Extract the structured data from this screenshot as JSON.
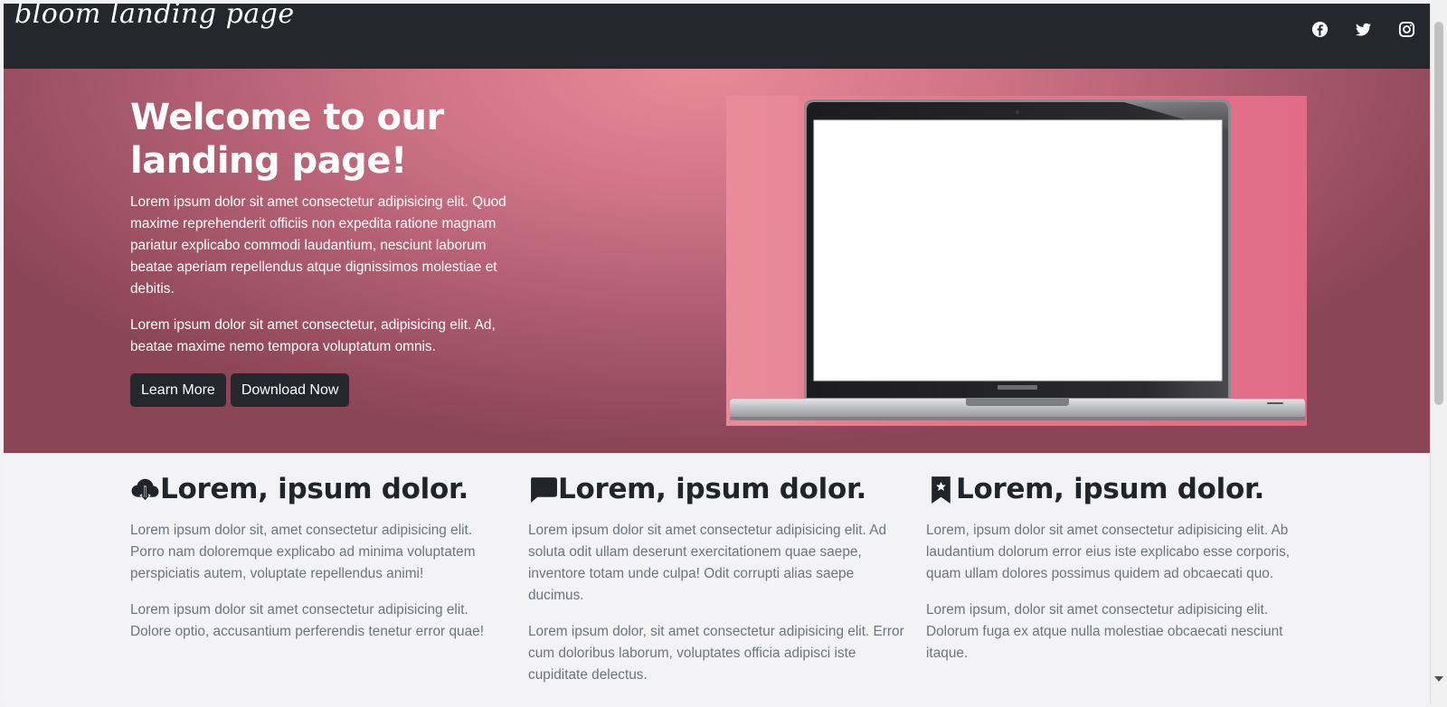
{
  "navbar": {
    "brand": "bloom landing page",
    "social": [
      {
        "name": "facebook-icon"
      },
      {
        "name": "twitter-icon"
      },
      {
        "name": "instagram-icon"
      }
    ]
  },
  "hero": {
    "title": "Welcome to our landing page!",
    "paragraph1": "Lorem ipsum dolor sit amet consectetur adipisicing elit. Quod maxime reprehenderit officiis non expedita ratione magnam pariatur explicabo commodi laudantium, nesciunt laborum beatae aperiam repellendus atque dignissimos molestiae et debitis.",
    "paragraph2": "Lorem ipsum dolor sit amet consectetur, adipisicing elit. Ad, beatae maxime nemo tempora voluptatum omnis.",
    "learn_more": "Learn More",
    "download_now": "Download Now",
    "image": "laptop-image",
    "accent_color": "#cf7386",
    "button_color": "#24272b"
  },
  "features": [
    {
      "icon": "cloud-download-icon",
      "title": "Lorem, ipsum dolor.",
      "p1": "Lorem ipsum dolor sit, amet consectetur adipisicing elit. Porro nam doloremque explicabo ad minima voluptatem perspiciatis autem, voluptate repellendus animi!",
      "p2": "Lorem ipsum dolor sit amet consectetur adipisicing elit. Dolore optio, accusantium perferendis tenetur error quae!"
    },
    {
      "icon": "chat-icon",
      "title": "Lorem, ipsum dolor.",
      "p1": "Lorem ipsum dolor sit amet consectetur adipisicing elit. Ad soluta odit ullam deserunt exercitationem quae saepe, inventore totam unde culpa! Odit corrupti alias saepe ducimus.",
      "p2": "Lorem ipsum dolor, sit amet consectetur adipisicing elit. Error cum doloribus laborum, voluptates officia adipisci iste cupiditate delectus."
    },
    {
      "icon": "bookmark-star-icon",
      "title": "Lorem, ipsum dolor.",
      "p1": "Lorem, ipsum dolor sit amet consectetur adipisicing elit. Ab laudantium dolorum error eius iste explicabo esse corporis, quam ullam dolores possimus quidem ad obcaecati quo.",
      "p2": "Lorem ipsum, dolor sit amet consectetur adipisicing elit. Dolorum fuga ex atque nulla molestiae obcaecati nesciunt itaque."
    }
  ]
}
